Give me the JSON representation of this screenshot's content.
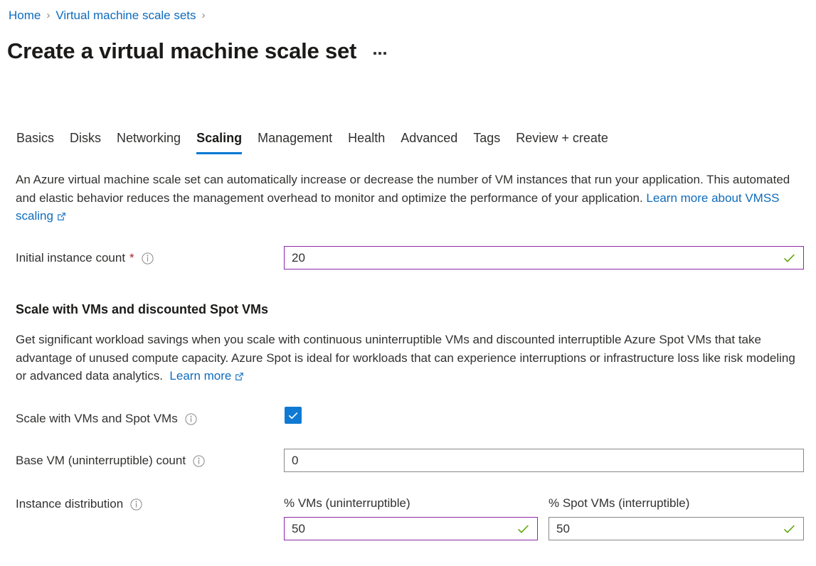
{
  "breadcrumb": {
    "items": [
      {
        "label": "Home"
      },
      {
        "label": "Virtual machine scale sets"
      }
    ],
    "separator": "›"
  },
  "header": {
    "title": "Create a virtual machine scale set",
    "more_options_label": "…"
  },
  "tabs": [
    {
      "label": "Basics",
      "active": false
    },
    {
      "label": "Disks",
      "active": false
    },
    {
      "label": "Networking",
      "active": false
    },
    {
      "label": "Scaling",
      "active": true
    },
    {
      "label": "Management",
      "active": false
    },
    {
      "label": "Health",
      "active": false
    },
    {
      "label": "Advanced",
      "active": false
    },
    {
      "label": "Tags",
      "active": false
    },
    {
      "label": "Review + create",
      "active": false
    }
  ],
  "intro": {
    "text": "An Azure virtual machine scale set can automatically increase or decrease the number of VM instances that run your application. This automated and elastic behavior reduces the management overhead to monitor and optimize the performance of your application.",
    "link_label": "Learn more about VMSS scaling"
  },
  "initial_instance_count": {
    "label": "Initial instance count",
    "required_marker": "*",
    "value": "20",
    "placeholder": "",
    "validation": "valid"
  },
  "spot_section": {
    "heading": "Scale with VMs and discounted Spot VMs",
    "description": "Get significant workload savings when you scale with continuous uninterruptible VMs and discounted interruptible Azure Spot VMs that take advantage of unused compute capacity. Azure Spot is ideal for workloads that can experience interruptions or infrastructure loss like risk modeling or advanced data analytics.",
    "link_label": "Learn more"
  },
  "scale_with_spot": {
    "label": "Scale with VMs and Spot VMs",
    "checked": true
  },
  "base_vm_count": {
    "label": "Base VM (uninterruptible) count",
    "value": "0",
    "placeholder": "",
    "validation": "none"
  },
  "instance_distribution": {
    "label": "Instance distribution",
    "columns": [
      {
        "label": "% VMs (uninterruptible)",
        "value": "50",
        "validation": "valid",
        "border": "purple"
      },
      {
        "label": "% Spot VMs (interruptible)",
        "value": "50",
        "validation": "valid",
        "border": "gray"
      }
    ]
  },
  "colors": {
    "link": "#0f6cbd",
    "tab_accent": "#0078d4",
    "checkbox_fill": "#0f7ad4",
    "required_star": "#a4262c",
    "valid_check": "#57a300",
    "input_focus_border": "#8d29a8",
    "input_border": "#8a8886"
  },
  "icons": {
    "info": "info-icon",
    "external_link": "external-link-icon",
    "checkmark": "checkmark-icon",
    "chevron_right": "chevron-right-icon"
  }
}
